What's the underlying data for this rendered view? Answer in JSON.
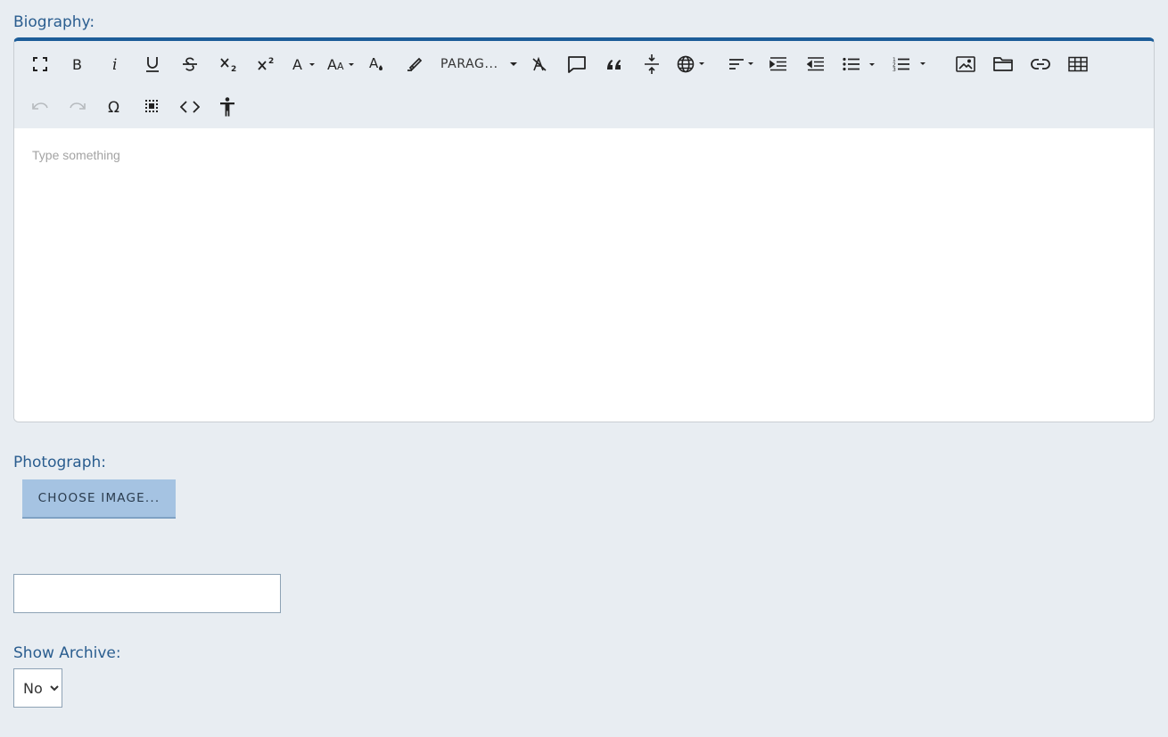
{
  "biography": {
    "label": "Biography:",
    "placeholder": "Type something",
    "toolbar": {
      "paragraph_label": "PARAG...",
      "row1": [
        "fullsize-icon",
        "bold-icon",
        "italic-icon",
        "underline-icon",
        "strikethrough-icon",
        "subscript-icon",
        "superscript-icon",
        "font-icon",
        "font-size-icon",
        "text-color-icon",
        "highlight-icon",
        "paragraph-dropdown",
        "clear-format-icon",
        "comment-icon",
        "blockquote-icon",
        "horizontal-rule-icon",
        "globe-icon",
        "align-icon",
        "indent-icon",
        "outdent-icon",
        "unordered-list-icon",
        "ordered-list-icon",
        "image-icon",
        "folder-icon",
        "link-icon",
        "table-icon"
      ],
      "row2": [
        "undo-icon",
        "redo-icon",
        "special-char-icon",
        "select-all-icon",
        "source-code-icon",
        "accessibility-icon"
      ]
    }
  },
  "photograph": {
    "label": "Photograph:",
    "choose_button": "CHOOSE IMAGE..."
  },
  "text_field": {
    "value": ""
  },
  "show_archive": {
    "label": "Show Archive:",
    "selected": "No"
  }
}
